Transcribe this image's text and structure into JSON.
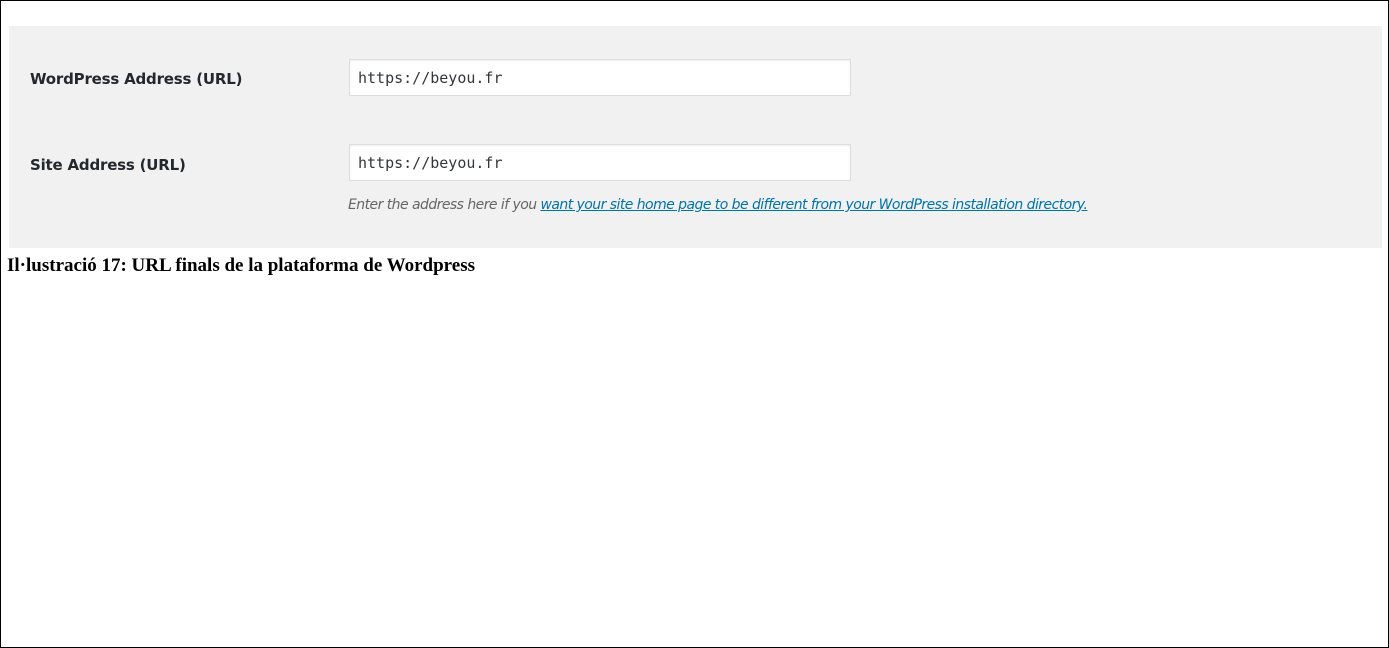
{
  "settings": {
    "wordpress_address": {
      "label": "WordPress Address (URL)",
      "value": "https://beyou.fr"
    },
    "site_address": {
      "label": "Site Address (URL)",
      "value": "https://beyou.fr"
    },
    "description": {
      "prefix": "Enter the address here if you ",
      "link_text": "want your site home page to be different from your WordPress installation directory."
    }
  },
  "caption": "Il·lustració 17: URL finals de la plataforma de Wordpress",
  "colors": {
    "panel_background": "#f1f1f1",
    "link": "#0073aa",
    "label_text": "#23282d",
    "description_text": "#666666"
  }
}
